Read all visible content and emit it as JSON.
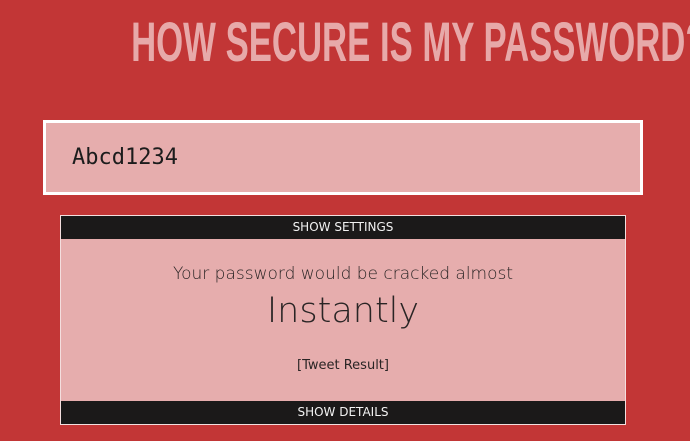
{
  "header": {
    "title": "HOW SECURE IS MY PASSWORD?"
  },
  "password_field": {
    "value": "Abcd1234"
  },
  "panel": {
    "settings_label": "SHOW SETTINGS",
    "result_intro": "Your password would be cracked almost",
    "result_time": "Instantly",
    "tweet_label": "[Tweet Result]",
    "details_label": "SHOW DETAILS"
  },
  "colors": {
    "background": "#c23636",
    "title": "#e7a9a9",
    "panel": "#e6adad",
    "bar": "#1b1919"
  }
}
